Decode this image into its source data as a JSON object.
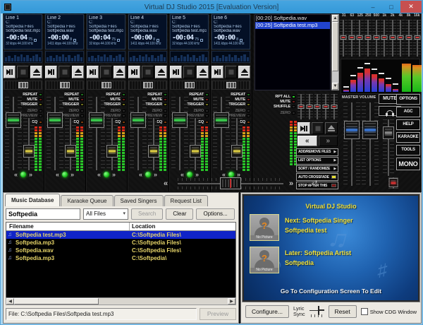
{
  "window": {
    "title": "Virtual DJ Studio 2015 [Evaluation Version]"
  },
  "channels": [
    {
      "name": "Line 1",
      "drive": "C:",
      "folder": "Softpedia Files",
      "file": "Softpedia test.mp3",
      "time": "-00:04",
      "badge": "75",
      "bitrate": "32 kbps 44.100 kHz"
    },
    {
      "name": "Line 2",
      "drive": "C:",
      "folder": "Softpedia Files",
      "file": "Softpedia.wav",
      "time": "-00:00",
      "badge": "8",
      "bitrate": "1411 kbps 44.100 kHz"
    },
    {
      "name": "Line 3",
      "drive": "C:",
      "folder": "Softpedia Files",
      "file": "Softpedia test.mp3",
      "time": "-00:04",
      "badge": "75",
      "bitrate": "32 kbps 44.100 kHz"
    },
    {
      "name": "Line 4",
      "drive": "C:",
      "folder": "Softpedia Files",
      "file": "Softpedia.wav",
      "time": "-00:00",
      "badge": "8",
      "bitrate": "1411 kbps 44.100 kHz"
    },
    {
      "name": "Line 5",
      "drive": "C:",
      "folder": "Softpedia Files",
      "file": "Softpedia test.mp3",
      "time": "-00:04",
      "badge": "75",
      "bitrate": "32 kbps 44.100 kHz"
    },
    {
      "name": "Line 6",
      "drive": "C:",
      "folder": "Softpedia Files",
      "file": "Softpedia.wav",
      "time": "-00:00",
      "badge": "8",
      "bitrate": "1411 kbps 44.100 kHz"
    }
  ],
  "channel_labels": {
    "repeat": "REPEAT",
    "mute": "MUTE",
    "trigger": "TRIGGER",
    "zero": "ZERO",
    "preview": "PREVIEW",
    "eq": "EQ"
  },
  "playlist": {
    "items": [
      {
        "text": "[00:20] Softpedia.wav",
        "selected": false
      },
      {
        "text": "[00:25] Softpedia test.mp3",
        "selected": true
      }
    ],
    "labels": {
      "rpt_all": "RPT ALL",
      "mute": "MUTE",
      "shuffle": "SHUFFLE",
      "zero": "ZERO"
    },
    "buttons": [
      {
        "label": "ADD/REMOVE FILES",
        "arrow": true
      },
      {
        "label": "LIST OPTIONS",
        "arrow": true
      },
      {
        "label": "SORT / RANDOMIZE",
        "arrow": true
      },
      {
        "label": "AUTO CROSSFADE",
        "led": "#e8e030"
      },
      {
        "label": "STOP AFTER THIS",
        "led": "#7a1414"
      }
    ]
  },
  "master": {
    "eq_labels": [
      "31",
      "63",
      "125",
      "250",
      "500",
      "1k",
      "2k",
      "4k",
      "8k",
      "16k"
    ],
    "analyzer": {
      "bars": [
        6,
        38,
        62,
        76,
        56,
        44,
        26,
        10
      ],
      "peaks": [
        14,
        50,
        74,
        88,
        70,
        56,
        40,
        22
      ],
      "meters": [
        90,
        86
      ]
    },
    "label": "MASTER VOLUME",
    "mute": "MUTE",
    "buttons": [
      {
        "label": "OPTIONS"
      },
      {
        "label": "AGC"
      },
      {
        "label": "HELP"
      },
      {
        "label": "KARAOKE"
      },
      {
        "label": "TOOLS"
      },
      {
        "label": "MONO",
        "big": true
      }
    ]
  },
  "library": {
    "tabs": [
      {
        "label": "Music Database",
        "active": true
      },
      {
        "label": "Karaoke Queue"
      },
      {
        "label": "Saved Singers"
      },
      {
        "label": "Request List"
      }
    ],
    "search": {
      "value": "Softpedia",
      "filter": "All Files",
      "search_btn": "Search",
      "clear_btn": "Clear",
      "options_btn": "Options..."
    },
    "table": {
      "columns": [
        "Filename",
        "Location"
      ],
      "rows": [
        {
          "filename": "Softpedia test.mp3",
          "location": "C:\\Softpedia Files\\",
          "selected": true,
          "noicon": true
        },
        {
          "filename": "Softpedia.mp3",
          "location": "C:\\Softpedia Files\\"
        },
        {
          "filename": "Softpedia.wav",
          "location": "C:\\Softpedia Files\\"
        },
        {
          "filename": "Softpedia.mp3",
          "location": "C:\\Softpedia\\"
        }
      ]
    },
    "status": "File: C:\\Softpedia Files\\Softpedia test.mp3",
    "preview_btn": "Preview"
  },
  "cdg": {
    "title": "Virtual DJ Studio",
    "next_line1": "Next: Softpedia Singer",
    "next_line2": "Softpedia test",
    "later_line1": "Later: Softpedia Artist",
    "later_line2": "Softpedia",
    "no_picture": "No Picture",
    "footer": "Go To Configuration Screen To Edit",
    "controls": {
      "configure": "Configure...",
      "lyric": "Lyric",
      "sync": "Sync",
      "reset": "Reset",
      "show_cdg": "Show CDG Window"
    }
  }
}
